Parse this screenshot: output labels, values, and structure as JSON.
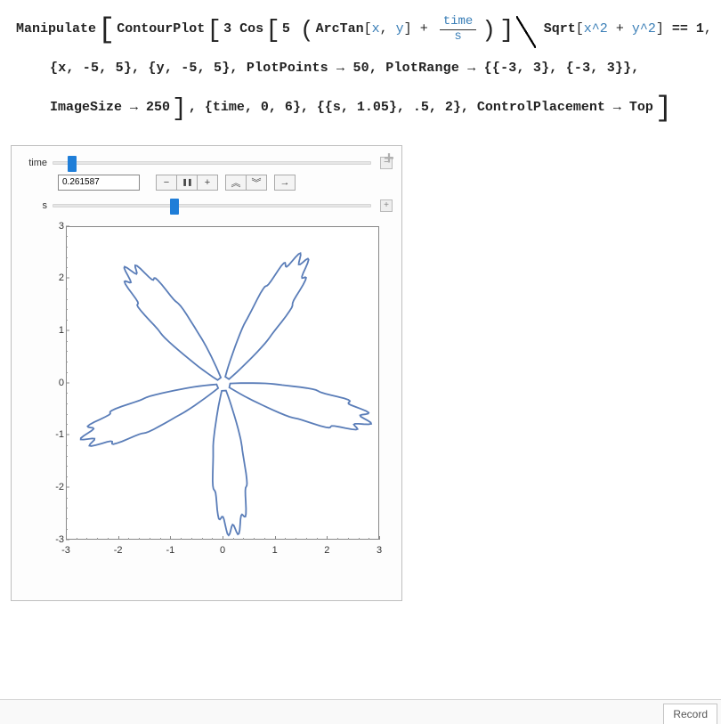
{
  "code": {
    "Manipulate": "Manipulate",
    "ContourPlot": "ContourPlot",
    "Cos": "Cos",
    "ArcTan": "ArcTan",
    "Sqrt": "Sqrt",
    "three": "3",
    "five": "5",
    "x": "x",
    "y": "y",
    "time": "time",
    "s": "s",
    "x2": "x^2",
    "y2": "y^2",
    "eq1": "== 1",
    "plus": "+",
    "comma": ",",
    "line2": "{x, -5, 5}, {y, -5, 5}, PlotPoints → 50, PlotRange → {{-3, 3}, {-3, 3}},",
    "line3a": "ImageSize → 250",
    "line3b": ", {time, 0, 6}, {{s, 1.05}, .5, 2}, ControlPlacement → Top"
  },
  "controls": {
    "time_label": "time",
    "s_label": "s",
    "time_value": "0.261587",
    "time_min": 0,
    "time_max": 6,
    "time_pos_pct": 4.4,
    "s_min": 0.5,
    "s_max": 2,
    "s_value": 1.05,
    "s_pos_pct": 36.7,
    "reveal_minus": "−",
    "reveal_plus": "+"
  },
  "anim_buttons": {
    "minus": "−",
    "pause": "❚❚",
    "plus": "+",
    "faster": "︽",
    "slower": "︾",
    "dir": "→"
  },
  "chart_data": {
    "type": "line",
    "title": "",
    "xlabel": "",
    "ylabel": "",
    "xlim": [
      -3,
      3
    ],
    "ylim": [
      -3,
      3
    ],
    "xticks": [
      -3,
      -2,
      -1,
      0,
      1,
      2,
      3
    ],
    "yticks": [
      -3,
      -2,
      -1,
      0,
      1,
      2,
      3
    ],
    "equation": "3*Cos(5*(ArcTan(x,y)+time/s)) / Sqrt(x^2+y^2) == 1",
    "params": {
      "time": 0.261587,
      "s": 1.05
    },
    "description": "Five-petal rose contour centered at origin, petals reaching roughly r≈2.5 to 3, rotated slightly clockwise.",
    "petal_tip_angles_deg_approx": [
      108,
      180,
      252,
      324,
      36
    ],
    "petal_radius_approx": 2.8,
    "color": "#5a7db8"
  },
  "bottom": {
    "record": "Record"
  }
}
